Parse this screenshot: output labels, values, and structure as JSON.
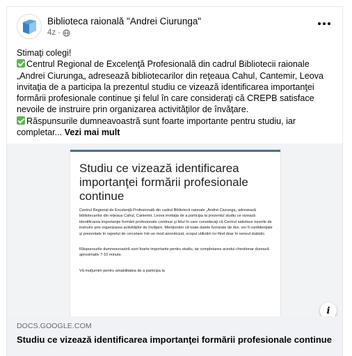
{
  "post": {
    "page_name": "Biblioteca raională \"Andrei Ciurunga\"",
    "timestamp": "4z",
    "meta_separator": "·",
    "paragraphs": [
      "Stimaţi colegi!",
      "Centrul Regional de Excelenţă Profesională  din cadrul Bibliotecii raionale „Andrei Ciurunga„ adresează bibliotecarilor din reţeaua Cahul, Cantemir, Leova invitaţia de a participa la prezentul studiu ce vizează identificarea importanţei formării profesionale continue şi felul în care consideraţi că CREPB satisface nevoile de instruire prin organizarea activităţilor de învăţare.",
      "Răspunsurile dumneavoastră sunt foarte importante pentru studiu, iar completar..."
    ],
    "see_more": "Vezi mai mult",
    "icons": {
      "avatar": "library-logo",
      "privacy": "globe-icon",
      "more": "more-horizontal-icon",
      "check": "check-mark-emoji"
    }
  },
  "link_card": {
    "preview": {
      "title": "Studiu  ce vizează identificarea importanţei formării profesionale continue",
      "paragraphs": [
        "Centrul Regional de Excelenţă Profesională  din cadrul Bibliotecii raionale „Andrei Ciurunga„ adresează bibliotecarilor din reţeaua Cahul, Cantemir, Leova invitaţia de a participa la prezentul studiu ce vizează identificarea importanţei formării profesionale continue şi felul în care consideraţi că Centrul satisface nevoile de instruire prin organizarea activităţilor de învăţare. Menţionăm că toate datele furnizate de dvs. vor fi confidenţiale şi prezentate în raportul de cercetare într-un mod anonimizat, scopul utilizării lor fiind doar în sensul statistic.",
        "Răspunsurile dumneavoastră sunt foarte importante pentru studiu, iar completarea acestui chestionar durează aproximativ 7-10 minute.",
        "Vă mulţumim pentru amabilitatea de a participa la"
      ]
    },
    "info_label": "i",
    "domain": "DOCS.GOOGLE.COM",
    "title": "Studiu ce vizează identificarea importanţei formării profesionale continue"
  },
  "colors": {
    "check_green": "#59b94a",
    "doc_accent": "#4e6f8a",
    "footer_bg": "#f0f2f5",
    "muted_text": "#65676b"
  }
}
